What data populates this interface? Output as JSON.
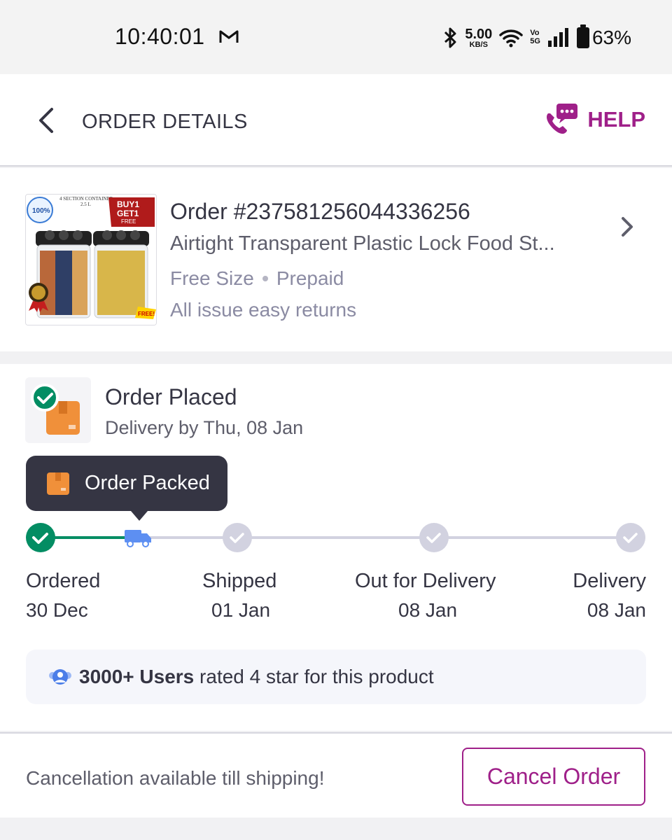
{
  "status_bar": {
    "time": "10:40:01",
    "mail_icon": "gmail-icon",
    "net_speed": "5.00",
    "net_speed_unit": "KB/S",
    "vo_top": "Vo",
    "vo_bottom": "5G",
    "battery": "63%"
  },
  "header": {
    "title": "ORDER DETAILS",
    "help_label": "HELP",
    "accent_color": "#9f2089"
  },
  "product": {
    "order_number": "Order #237581256044336256",
    "name": "Airtight Transparent Plastic Lock Food St...",
    "size": "Free Size",
    "payment": "Prepaid",
    "returns": "All issue easy returns",
    "thumb_text": {
      "container": "4 SECTION CONTAINER",
      "volume": "2.5 L",
      "offer_line1": "BUY1",
      "offer_line2": "GET1",
      "offer_line3": "FREE",
      "badge": "100%",
      "free_tag": "FREE!"
    }
  },
  "tracking": {
    "status_title": "Order Placed",
    "status_sub": "Delivery by  Thu, 08 Jan",
    "tooltip_label": "Order Packed",
    "steps": [
      {
        "label": "Ordered",
        "date": "30 Dec",
        "state": "done"
      },
      {
        "label": "Shipped",
        "date": "01 Jan",
        "state": "pending"
      },
      {
        "label": "Out for Delivery",
        "date": "08 Jan",
        "state": "pending"
      },
      {
        "label": "Delivery",
        "date": "08 Jan",
        "state": "pending"
      }
    ],
    "progress_color": "#038d63",
    "pending_color": "#d2d2e0",
    "truck_color": "#5d8ff2"
  },
  "rating": {
    "bold": "3000+ Users",
    "rest": " rated 4 star for this product"
  },
  "footer": {
    "cancel_note": "Cancellation available till shipping!",
    "cancel_button": "Cancel Order"
  }
}
